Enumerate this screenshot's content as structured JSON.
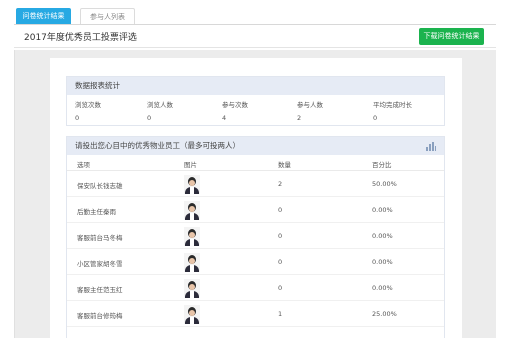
{
  "tabs": [
    {
      "label": "问卷统计结果"
    },
    {
      "label": "参与人列表"
    }
  ],
  "header": {
    "title": "2017年度优秀员工投票评选",
    "download_label": "下载问卷统计结果"
  },
  "stats": {
    "title": "数据报表统计",
    "columns": [
      "浏览次数",
      "浏览人数",
      "参与次数",
      "参与人数",
      "平均完成时长"
    ],
    "values": [
      "0",
      "0",
      "4",
      "2",
      "0"
    ]
  },
  "vote": {
    "title": "请投出您心目中的优秀物业员工（最多可投两人）",
    "chart_icon": "bar-chart-icon",
    "headers": [
      "选项",
      "图片",
      "数量",
      "百分比"
    ],
    "rows": [
      {
        "option": "保安队长钱志雄",
        "count": "2",
        "percent": "50.00%"
      },
      {
        "option": "后勤主任秦雨",
        "count": "0",
        "percent": "0.00%"
      },
      {
        "option": "客服前台马冬梅",
        "count": "0",
        "percent": "0.00%"
      },
      {
        "option": "小区管家胡冬雪",
        "count": "0",
        "percent": "0.00%"
      },
      {
        "option": "客服主任范玉红",
        "count": "0",
        "percent": "0.00%"
      },
      {
        "option": "客服前台修筠梅",
        "count": "1",
        "percent": "25.00%"
      }
    ]
  },
  "colors": {
    "tab_active": "#27a9e3",
    "download_button": "#1bb34e",
    "panel_header": "#e6ebf5",
    "canvas": "#ececec"
  }
}
